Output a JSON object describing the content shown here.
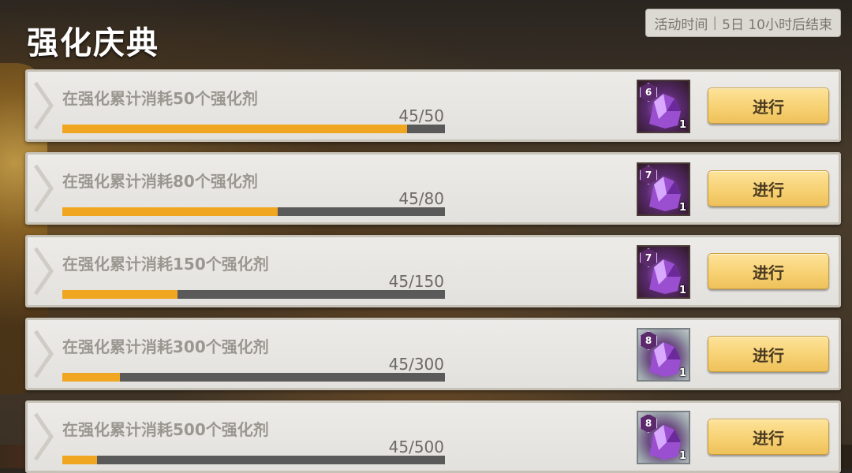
{
  "page": {
    "title": "强化庆典",
    "time_label": "活动时间",
    "time_value": "5日 10小时后结束"
  },
  "tasks": [
    {
      "label": "在强化累计消耗50个强化剂",
      "progress_text": "45/50",
      "current": 45,
      "target": 50,
      "reward_level": "6",
      "reward_qty": "1",
      "reward_bg": "dark",
      "button": "进行"
    },
    {
      "label": "在强化累计消耗80个强化剂",
      "progress_text": "45/80",
      "current": 45,
      "target": 80,
      "reward_level": "7",
      "reward_qty": "1",
      "reward_bg": "dark",
      "button": "进行"
    },
    {
      "label": "在强化累计消耗150个强化剂",
      "progress_text": "45/150",
      "current": 45,
      "target": 150,
      "reward_level": "7",
      "reward_qty": "1",
      "reward_bg": "dark",
      "button": "进行"
    },
    {
      "label": "在强化累计消耗300个强化剂",
      "progress_text": "45/300",
      "current": 45,
      "target": 300,
      "reward_level": "8",
      "reward_qty": "1",
      "reward_bg": "gray",
      "button": "进行"
    },
    {
      "label": "在强化累计消耗500个强化剂",
      "progress_text": "45/500",
      "current": 45,
      "target": 500,
      "reward_level": "8",
      "reward_qty": "1",
      "reward_bg": "gray",
      "button": "进行"
    }
  ],
  "colors": {
    "progress_fill": "#f0a621",
    "progress_track": "#5a5a5a",
    "button_gold": "#f7d173"
  },
  "icons": {
    "row_marker": "chevron-right-icon",
    "reward": "purple-crystal-icon"
  }
}
